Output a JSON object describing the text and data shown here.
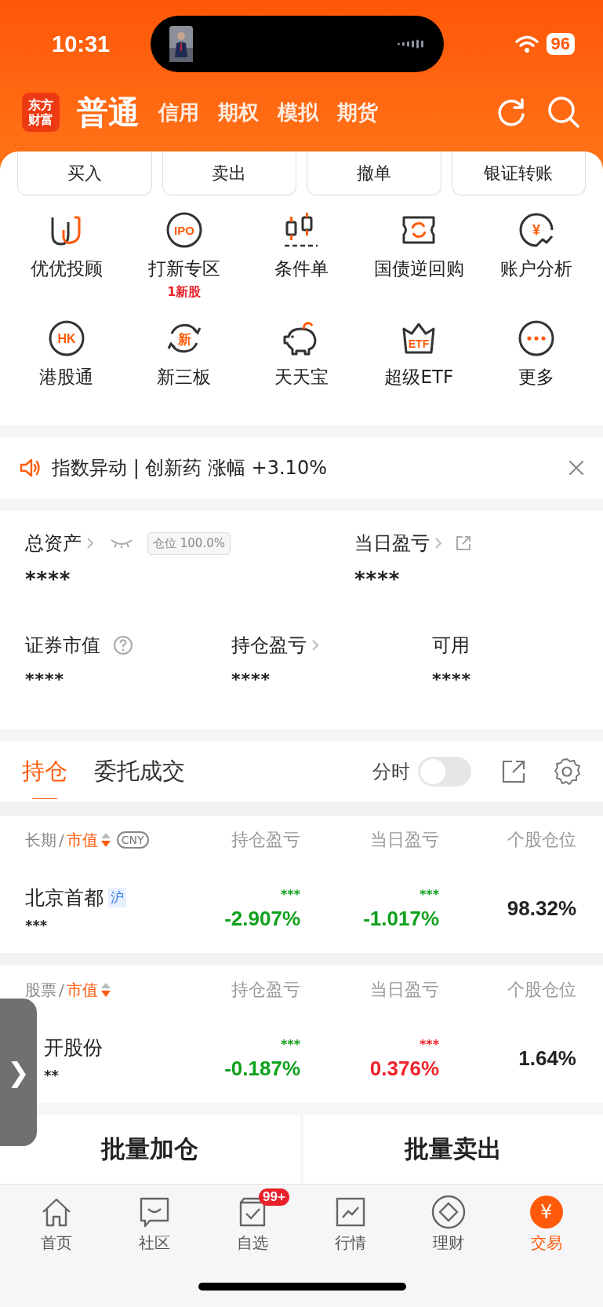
{
  "status_bar": {
    "time": "10:31",
    "battery": "96"
  },
  "header": {
    "logo": [
      "东方",
      "财富"
    ],
    "tabs": [
      {
        "label": "普通",
        "selected": true
      },
      {
        "label": "信用",
        "selected": false
      },
      {
        "label": "期权",
        "selected": false
      },
      {
        "label": "模拟",
        "selected": false
      },
      {
        "label": "期货",
        "selected": false
      }
    ]
  },
  "quick_actions": [
    "买入",
    "卖出",
    "撤单",
    "银证转账"
  ],
  "shortcuts": [
    {
      "label": "优优投顾",
      "kind": "uu"
    },
    {
      "label": "打新专区",
      "kind": "ipo",
      "icon_text": "IPO",
      "badge": "1新股"
    },
    {
      "label": "条件单",
      "kind": "candles"
    },
    {
      "label": "国债逆回购",
      "kind": "ticket"
    },
    {
      "label": "账户分析",
      "kind": "yen",
      "icon_text": "¥"
    },
    {
      "label": "港股通",
      "kind": "hk",
      "icon_text": "HK"
    },
    {
      "label": "新三板",
      "kind": "cycle",
      "icon_text": "新"
    },
    {
      "label": "天天宝",
      "kind": "piggy"
    },
    {
      "label": "超级ETF",
      "kind": "crown",
      "icon_text": "ETF"
    },
    {
      "label": "更多",
      "kind": "more"
    }
  ],
  "notice": {
    "text": "指数异动 | 创新药 涨幅 +3.10%"
  },
  "account": {
    "total": {
      "label": "总资产",
      "value": "****",
      "position_badge": "仓位 100.0%"
    },
    "today": {
      "label": "当日盈亏",
      "value": "****"
    },
    "metrics": [
      {
        "label": "证券市值",
        "value": "****",
        "kind": "help"
      },
      {
        "label": "持仓盈亏",
        "value": "****",
        "kind": "link"
      },
      {
        "label": "可用",
        "value": "****",
        "kind": "plain"
      }
    ]
  },
  "holdings_tabs": [
    {
      "label": "持仓",
      "selected": true
    },
    {
      "label": "委托成交",
      "selected": false
    }
  ],
  "timeshare": {
    "label": "分时",
    "on": false
  },
  "groups": [
    {
      "category": "长期",
      "separator": "/",
      "sort": "市值",
      "currency": "CNY",
      "columns": [
        "持仓盈亏",
        "当日盈亏",
        "个股仓位"
      ],
      "rows": [
        {
          "name": "北京首都",
          "market": "沪",
          "amount": "***",
          "pnl": {
            "amount": "***",
            "percent": "-2.907%",
            "color": "#0fa01c"
          },
          "day": {
            "amount": "***",
            "percent": "-1.017%",
            "color": "#0fa01c"
          },
          "weight": "98.32%"
        }
      ]
    },
    {
      "category": "股票",
      "separator": "/",
      "sort": "市值",
      "columns": [
        "持仓盈亏",
        "当日盈亏",
        "个股仓位"
      ],
      "rows": [
        {
          "name": "开股份",
          "amount": "**",
          "clipped": true,
          "pnl": {
            "amount": "***",
            "percent": "-0.187%",
            "color": "#0fa01c"
          },
          "day": {
            "amount": "***",
            "percent": "0.376%",
            "color": "#f0212a"
          },
          "weight": "1.64%"
        }
      ]
    }
  ],
  "side_handle": {
    "glyph": "❯"
  },
  "batch_buttons": [
    "批量加仓",
    "批量卖出"
  ],
  "nav": [
    {
      "label": "首页",
      "kind": "home",
      "selected": false
    },
    {
      "label": "社区",
      "kind": "chat",
      "selected": false
    },
    {
      "label": "自选",
      "kind": "watch",
      "selected": false,
      "badge": "99+"
    },
    {
      "label": "行情",
      "kind": "chart",
      "selected": false
    },
    {
      "label": "理财",
      "kind": "diamond",
      "selected": false
    },
    {
      "label": "交易",
      "kind": "trade",
      "selected": true,
      "icon_text": "¥"
    }
  ]
}
